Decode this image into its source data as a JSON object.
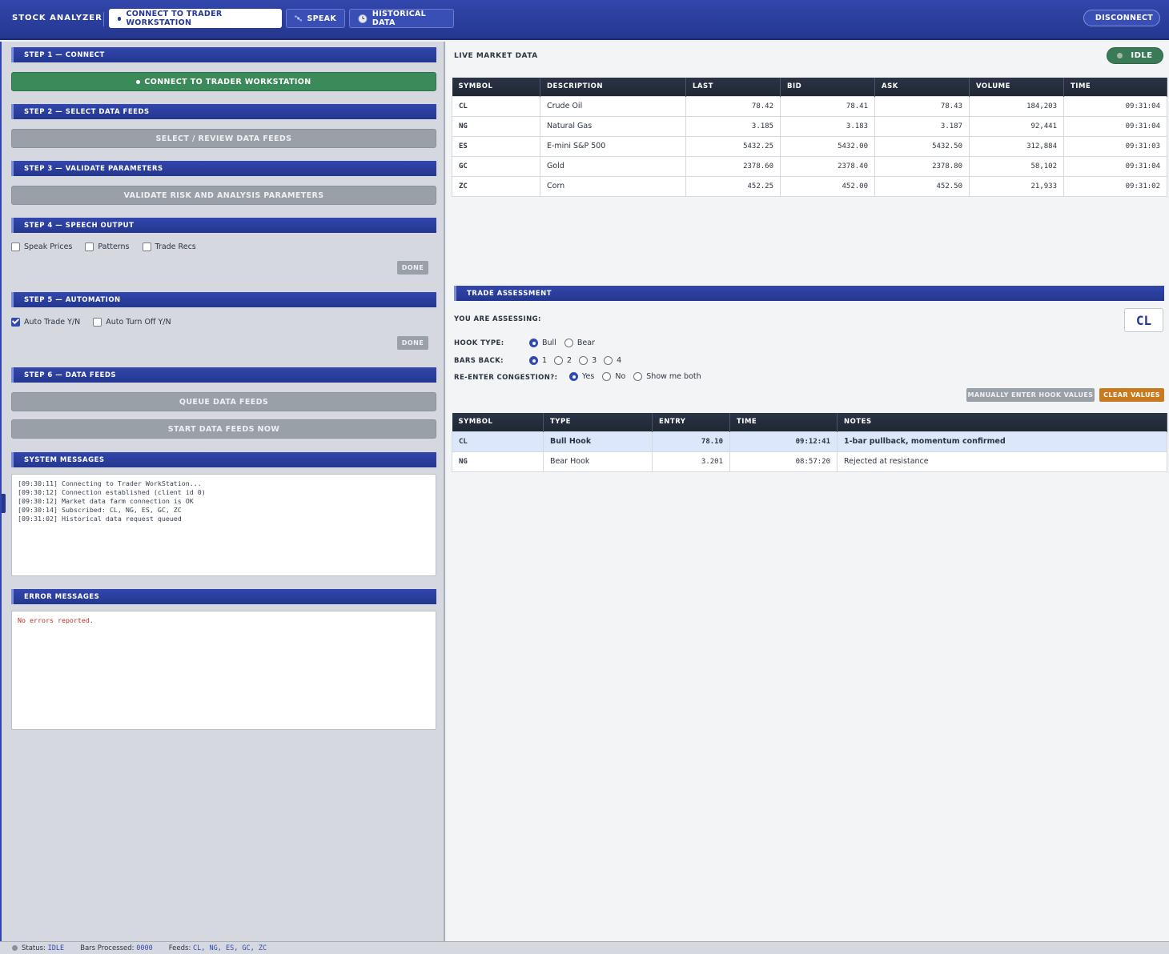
{
  "app": {
    "title": "STOCK ANALYZER",
    "connect_tab": "CONNECT TO TRADER WORKSTATION",
    "speak_tab": "SPEAK",
    "historical_tab": "HISTORICAL DATA",
    "disconnect": "DISCONNECT"
  },
  "steps": {
    "s1": "STEP 1 — CONNECT",
    "s1_button": "CONNECT TO TRADER WORKSTATION",
    "s2": "STEP 2 — SELECT DATA FEEDS",
    "s2_button": "SELECT / REVIEW DATA FEEDS",
    "s3": "STEP 3 — VALIDATE PARAMETERS",
    "s3_button": "VALIDATE RISK AND ANALYSIS PARAMETERS",
    "s4": "STEP 4 — SPEECH OUTPUT",
    "s4_options": [
      {
        "label": "Speak Prices",
        "checked": false
      },
      {
        "label": "Patterns",
        "checked": false
      },
      {
        "label": "Trade Recs",
        "checked": false
      }
    ],
    "done": "DONE",
    "s5": "STEP 5 — AUTOMATION",
    "s5_options": [
      {
        "label": "Auto Trade Y/N",
        "checked": true
      },
      {
        "label": "Auto Turn Off Y/N",
        "checked": false
      }
    ],
    "s6": "STEP 6 — DATA FEEDS",
    "s6_queue": "QUEUE DATA FEEDS",
    "s6_start": "START DATA FEEDS NOW"
  },
  "system_messages": {
    "title": "SYSTEM MESSAGES",
    "text": "[09:30:11] Connecting to Trader WorkStation...\n[09:30:12] Connection established (client id 0)\n[09:30:12] Market data farm connection is OK\n[09:30:14] Subscribed: CL, NG, ES, GC, ZC\n[09:31:02] Historical data request queued"
  },
  "error_messages": {
    "title": "ERROR MESSAGES",
    "text": "No errors reported."
  },
  "market": {
    "title": "LIVE MARKET DATA",
    "status": "IDLE",
    "columns": [
      "SYMBOL",
      "DESCRIPTION",
      "LAST",
      "BID",
      "ASK",
      "VOLUME",
      "TIME"
    ],
    "rows": [
      [
        "CL",
        "Crude Oil",
        "78.42",
        "78.41",
        "78.43",
        "184,203",
        "09:31:04"
      ],
      [
        "NG",
        "Natural Gas",
        "3.185",
        "3.183",
        "3.187",
        "92,441",
        "09:31:04"
      ],
      [
        "ES",
        "E-mini S&P 500",
        "5432.25",
        "5432.00",
        "5432.50",
        "312,884",
        "09:31:03"
      ],
      [
        "GC",
        "Gold",
        "2378.60",
        "2378.40",
        "2378.80",
        "58,102",
        "09:31:04"
      ],
      [
        "ZC",
        "Corn",
        "452.25",
        "452.00",
        "452.50",
        "21,933",
        "09:31:02"
      ]
    ]
  },
  "assessment": {
    "title": "TRADE ASSESSMENT",
    "assessing_label": "YOU ARE ASSESSING:",
    "symbol": "CL",
    "hook_label": "HOOK TYPE:",
    "hook_options": [
      {
        "label": "Bull",
        "on": true
      },
      {
        "label": "Bear",
        "on": false
      }
    ],
    "bars_label": "BARS BACK:",
    "bars_options": [
      {
        "label": "1",
        "on": true
      },
      {
        "label": "2",
        "on": false
      },
      {
        "label": "3",
        "on": false
      },
      {
        "label": "4",
        "on": false
      }
    ],
    "reenter_label": "RE-ENTER CONGESTION?:",
    "reenter_options": [
      {
        "label": "Yes",
        "on": true
      },
      {
        "label": "No",
        "on": false
      },
      {
        "label": "Show me both",
        "on": false
      }
    ],
    "manual_button": "MANUALLY ENTER HOOK VALUES",
    "clear_button": "CLEAR VALUES",
    "columns": [
      "SYMBOL",
      "TYPE",
      "ENTRY",
      "TIME",
      "NOTES"
    ],
    "rows": [
      [
        "CL",
        "Bull Hook",
        "78.10",
        "09:12:41",
        "1-bar pullback, momentum confirmed"
      ],
      [
        "NG",
        "Bear Hook",
        "3.201",
        "08:57:20",
        "Rejected at resistance"
      ]
    ]
  },
  "statusbar": {
    "status_label": "Status:",
    "status_value": "IDLE",
    "bars_label": "Bars Processed:",
    "bars_value": "0000",
    "feeds_label": "Feeds:",
    "feeds_value": "CL, NG, ES, GC, ZC"
  }
}
